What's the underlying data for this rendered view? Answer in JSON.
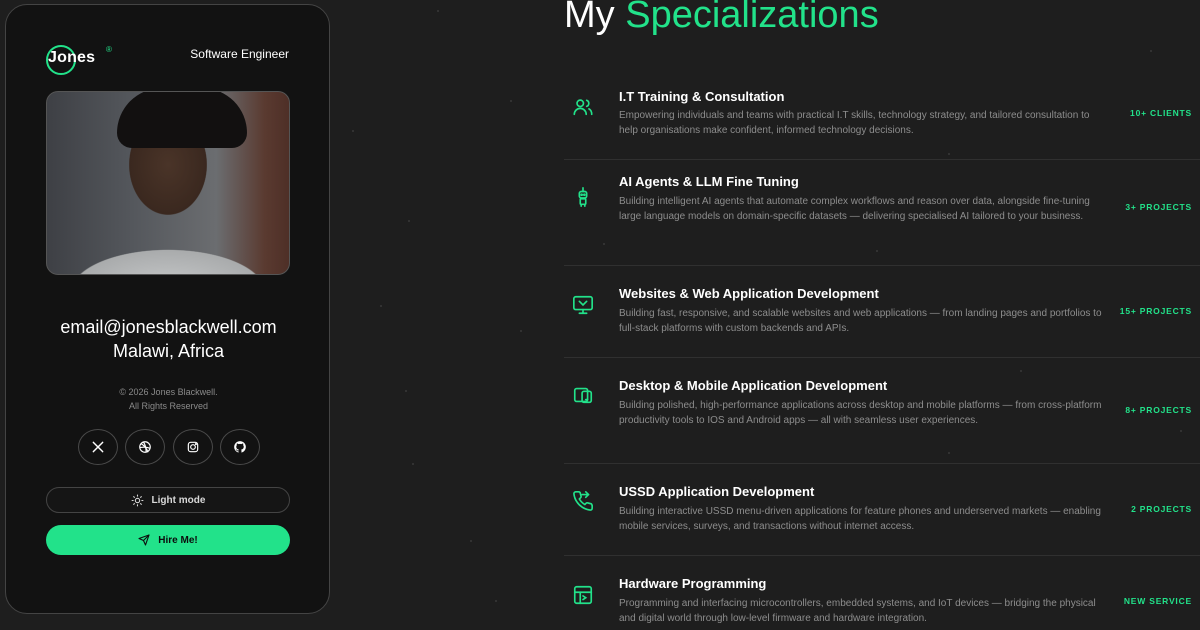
{
  "profile": {
    "logo_text": "Jones",
    "logo_mark": "®",
    "role": "Software Engineer",
    "email": "email@jonesblackwell.com",
    "location": "Malawi, Africa",
    "copyright_line1": "© 2026 Jones Blackwell.",
    "copyright_line2": "All Rights Reserved",
    "socials": [
      {
        "icon": "x-icon"
      },
      {
        "icon": "dribbble-icon"
      },
      {
        "icon": "instagram-icon"
      },
      {
        "icon": "github-icon"
      }
    ],
    "mode_label": "Light mode",
    "hire_label": "Hire Me!"
  },
  "heading": {
    "prefix": "My",
    "accent": "Specializations"
  },
  "accent_color": "#22e28a",
  "services": [
    {
      "icon": "users-icon",
      "title": "I.T Training & Consultation",
      "desc": "Empowering individuals and teams with practical I.T skills, technology strategy, and tailored consultation to help organisations make confident, informed technology decisions.",
      "badge": "10+ CLIENTS"
    },
    {
      "icon": "robot-icon",
      "title": "AI Agents & LLM Fine Tuning",
      "desc": "Building intelligent AI agents that automate complex workflows and reason over data, alongside fine-tuning large language models on domain-specific datasets — delivering specialised AI tailored to your business.",
      "badge": "3+ PROJECTS"
    },
    {
      "icon": "monitor-icon",
      "title": "Websites & Web Application Development",
      "desc": "Building fast, responsive, and scalable websites and web applications — from landing pages and portfolios to full-stack platforms with custom backends and APIs.",
      "badge": "15+ PROJECTS"
    },
    {
      "icon": "devices-icon",
      "title": "Desktop & Mobile Application Development",
      "desc": "Building polished, high-performance applications across desktop and mobile platforms — from cross-platform productivity tools to IOS and Android apps — all with seamless user experiences.",
      "badge": "8+ PROJECTS"
    },
    {
      "icon": "phone-icon",
      "title": "USSD Application Development",
      "desc": "Building interactive USSD menu-driven applications for feature phones and underserved markets — enabling mobile services, surveys, and transactions without internet access.",
      "badge": "2 PROJECTS"
    },
    {
      "icon": "circuit-icon",
      "title": "Hardware Programming",
      "desc": "Programming and interfacing microcontrollers, embedded systems, and IoT devices — bridging the physical and digital world through low-level firmware and hardware integration.",
      "badge": "NEW SERVICE"
    }
  ]
}
